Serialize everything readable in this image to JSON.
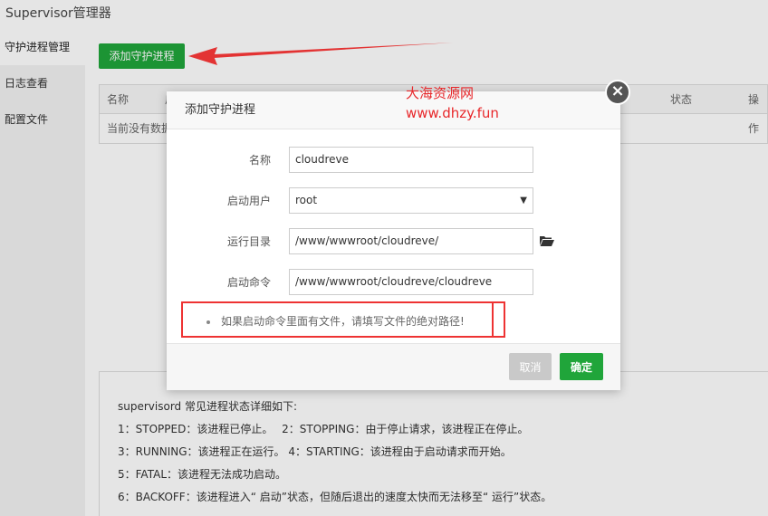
{
  "app": {
    "title": "Supervisor管理器"
  },
  "sidebar": {
    "items": [
      {
        "label": "守护进程管理"
      },
      {
        "label": "日志查看"
      },
      {
        "label": "配置文件"
      }
    ]
  },
  "toolbar": {
    "add_label": "添加守护进程"
  },
  "table": {
    "headers": [
      "名称",
      "启",
      "状态",
      "操作"
    ],
    "empty_text": "当前没有数据"
  },
  "info": {
    "lines": [
      "supervisord 常见进程状态详细如下:",
      "1：STOPPED：该进程已停止。　 2：STOPPING：由于停止请求，该进程正在停止。",
      "3：RUNNING：该进程正在运行。 4：STARTING：该进程由于启动请求而开始。",
      "5：FATAL：该进程无法成功启动。",
      "6：BACKOFF：该进程进入“ 启动”状态，但随后退出的速度太快而无法移至“ 运行”状态。"
    ]
  },
  "modal": {
    "title": "添加守护进程",
    "close_glyph": "×",
    "fields": {
      "name": {
        "label": "名称",
        "value": "cloudreve"
      },
      "user": {
        "label": "启动用户",
        "value": "root"
      },
      "dir": {
        "label": "运行目录",
        "value": "/www/wwwroot/cloudreve/"
      },
      "cmd": {
        "label": "启动命令",
        "value": "/www/wwwroot/cloudreve/cloudreve"
      }
    },
    "hint": "如果启动命令里面有文件，请填写文件的绝对路径!",
    "cancel_label": "取消",
    "ok_label": "确定"
  },
  "watermark": {
    "line1": "大海资源网",
    "line2": "www.dhzy.fun"
  },
  "colors": {
    "accent": "#20a53a",
    "annotation": "#e33333",
    "watermark": "#e8282b"
  },
  "icons": {
    "folder": "folder-open-icon",
    "caret": "caret-down-icon",
    "close": "close-icon"
  }
}
